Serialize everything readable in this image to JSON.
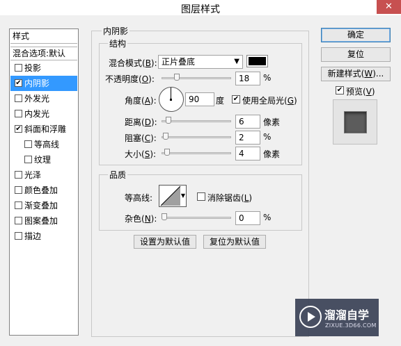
{
  "window": {
    "title": "图层样式",
    "close_glyph": "✕"
  },
  "left_panel": {
    "header": "样式",
    "blend_options": "混合选项:默认",
    "items": [
      {
        "label": "投影",
        "checked": false,
        "indent": false,
        "selected": false
      },
      {
        "label": "内阴影",
        "checked": true,
        "indent": false,
        "selected": true
      },
      {
        "label": "外发光",
        "checked": false,
        "indent": false,
        "selected": false
      },
      {
        "label": "内发光",
        "checked": false,
        "indent": false,
        "selected": false
      },
      {
        "label": "斜面和浮雕",
        "checked": true,
        "indent": false,
        "selected": false
      },
      {
        "label": "等高线",
        "checked": false,
        "indent": true,
        "selected": false
      },
      {
        "label": "纹理",
        "checked": false,
        "indent": true,
        "selected": false
      },
      {
        "label": "光泽",
        "checked": false,
        "indent": false,
        "selected": false
      },
      {
        "label": "颜色叠加",
        "checked": false,
        "indent": false,
        "selected": false
      },
      {
        "label": "渐变叠加",
        "checked": false,
        "indent": false,
        "selected": false
      },
      {
        "label": "图案叠加",
        "checked": false,
        "indent": false,
        "selected": false
      },
      {
        "label": "描边",
        "checked": false,
        "indent": false,
        "selected": false
      }
    ]
  },
  "inner_shadow": {
    "section_title": "内阴影",
    "structure": {
      "title": "结构",
      "blend_mode": {
        "label": "混合模式(",
        "key": "B",
        "suffix": "):",
        "value": "正片叠底",
        "color": "#000000"
      },
      "opacity": {
        "label": "不透明度(",
        "key": "O",
        "suffix": "):",
        "value": "18",
        "unit": "%",
        "level": 18
      },
      "angle": {
        "label": "角度(",
        "key": "A",
        "suffix": "):",
        "value": "90",
        "unit": "度",
        "global_light_checked": true,
        "global_light_prefix": "使用全局光(",
        "global_light_key": "G",
        "global_light_suffix": ")"
      },
      "distance": {
        "label": "距离(",
        "key": "D",
        "suffix": "):",
        "value": "6",
        "unit": "像素",
        "level": 6
      },
      "choke": {
        "label": "阻塞(",
        "key": "C",
        "suffix": "):",
        "value": "2",
        "unit": "%",
        "level": 2
      },
      "size": {
        "label": "大小(",
        "key": "S",
        "suffix": "):",
        "value": "4",
        "unit": "像素",
        "level": 4
      }
    },
    "quality": {
      "title": "品质",
      "contour_label": "等高线:",
      "anti_alias": {
        "label": "消除锯齿(",
        "key": "L",
        "suffix": ")",
        "checked": false
      },
      "noise": {
        "label": "杂色(",
        "key": "N",
        "suffix": "):",
        "value": "0",
        "unit": "%",
        "level": 0
      }
    },
    "buttons": {
      "make_default": "设置为默认值",
      "reset_default": "复位为默认值"
    }
  },
  "right_panel": {
    "ok": "确定",
    "reset": "复位",
    "new_style": {
      "prefix": "新建样式(",
      "key": "W",
      "suffix": ")..."
    },
    "preview": {
      "prefix": "预览(",
      "key": "V",
      "suffix": ")",
      "checked": true
    }
  },
  "watermark": {
    "brand": "溜溜自学",
    "url": "ZIXUE.3D66.COM"
  }
}
